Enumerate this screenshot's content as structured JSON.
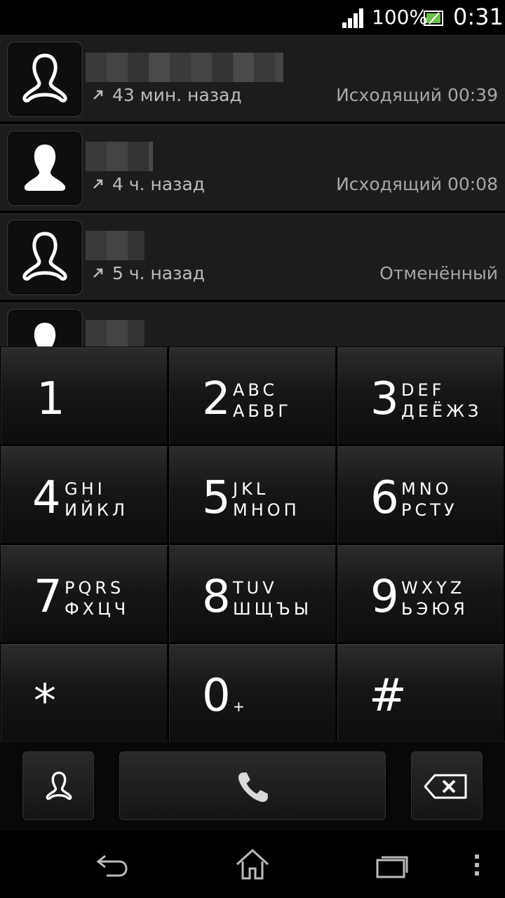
{
  "status_bar": {
    "battery_percent": "100%",
    "time": "0:31"
  },
  "call_log": [
    {
      "avatar": "outline-person-icon",
      "direction": "outgoing-arrow-icon",
      "time": "43 мин. назад",
      "status": "Исходящий 00:39"
    },
    {
      "avatar": "solid-person-icon",
      "direction": "outgoing-arrow-icon",
      "time": "4 ч. назад",
      "status": "Исходящий 00:08"
    },
    {
      "avatar": "outline-person-icon",
      "direction": "outgoing-arrow-icon",
      "time": "5 ч. назад",
      "status": "Отменённый"
    },
    {
      "avatar": "solid-person-icon",
      "direction": "",
      "time": "",
      "status": ""
    }
  ],
  "dialpad": [
    {
      "digit": "1",
      "latin": "",
      "cyrillic": ""
    },
    {
      "digit": "2",
      "latin": "ABC",
      "cyrillic": "АБВГ"
    },
    {
      "digit": "3",
      "latin": "DEF",
      "cyrillic": "ДЕЁЖЗ"
    },
    {
      "digit": "4",
      "latin": "GHI",
      "cyrillic": "ИЙКЛ"
    },
    {
      "digit": "5",
      "latin": "JKL",
      "cyrillic": "МНОП"
    },
    {
      "digit": "6",
      "latin": "MNO",
      "cyrillic": "РСТУ"
    },
    {
      "digit": "7",
      "latin": "PQRS",
      "cyrillic": "ФХЦЧ"
    },
    {
      "digit": "8",
      "latin": "TUV",
      "cyrillic": "ШЩЪЫ"
    },
    {
      "digit": "9",
      "latin": "WXYZ",
      "cyrillic": "ЬЭЮЯ"
    },
    {
      "digit": "*",
      "latin": "",
      "cyrillic": ""
    },
    {
      "digit": "0",
      "latin": "+",
      "cyrillic": ""
    },
    {
      "digit": "#",
      "latin": "",
      "cyrillic": ""
    }
  ],
  "action_bar": {
    "contacts_icon": "person-outline-icon",
    "call_icon": "phone-handset-icon",
    "backspace_icon": "backspace-icon"
  },
  "nav_bar": {
    "back_icon": "back-icon",
    "home_icon": "home-icon",
    "recents_icon": "recent-apps-icon",
    "menu_icon": "overflow-menu-icon"
  },
  "colors": {
    "row_bg": "#1c1c1c",
    "key_text": "#ffffff",
    "secondary_text": "#bdbdbd"
  }
}
